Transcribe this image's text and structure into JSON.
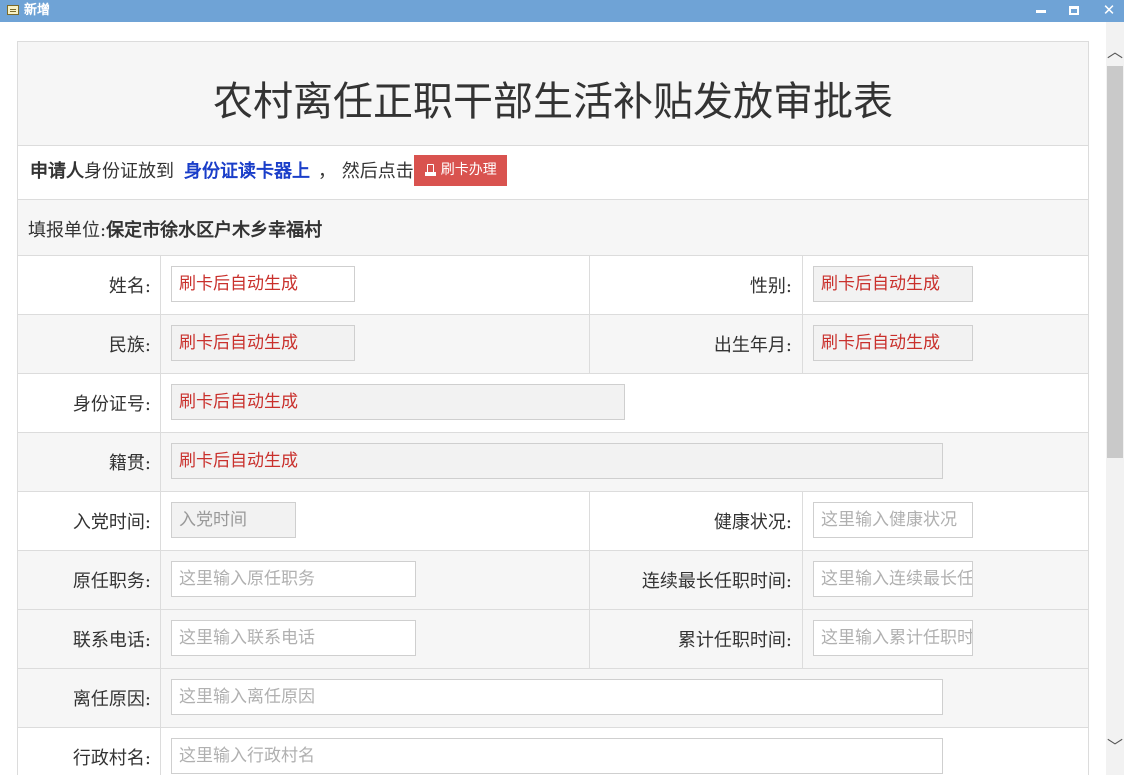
{
  "window": {
    "title": "新增"
  },
  "form": {
    "title": "农村离任正职干部生活补贴发放审批表",
    "notice": {
      "applicant": "申请人",
      "text1": "身份证放到",
      "reader": "身份证读卡器上",
      "text2": "，  然后点击",
      "button": "刷卡办理"
    },
    "unit": {
      "label": "填报单位:",
      "value": "保定市徐水区户木乡幸福村"
    },
    "fields": {
      "name": {
        "label": "姓名:",
        "value": "刷卡后自动生成"
      },
      "gender": {
        "label": "性别:",
        "value": "刷卡后自动生成"
      },
      "ethnicity": {
        "label": "民族:",
        "value": "刷卡后自动生成"
      },
      "birth": {
        "label": "出生年月:",
        "value": "刷卡后自动生成"
      },
      "id_number": {
        "label": "身份证号:",
        "value": "刷卡后自动生成"
      },
      "native_place": {
        "label": "籍贯:",
        "value": "刷卡后自动生成"
      },
      "party_date": {
        "label": "入党时间:",
        "value": "入党时间"
      },
      "health": {
        "label": "健康状况:",
        "placeholder": "这里输入健康状况"
      },
      "former_post": {
        "label": "原任职务:",
        "placeholder": "这里输入原任职务"
      },
      "longest_term": {
        "label": "连续最长任职时间:",
        "placeholder": "这里输入连续最长任职时间"
      },
      "phone": {
        "label": "联系电话:",
        "placeholder": "这里输入联系电话"
      },
      "total_term": {
        "label": "累计任职时间:",
        "placeholder": "这里输入累计任职时间"
      },
      "leave_reason": {
        "label": "离任原因:",
        "placeholder": "这里输入离任原因"
      },
      "village": {
        "label": "行政村名:",
        "placeholder": "这里输入行政村名"
      }
    }
  }
}
